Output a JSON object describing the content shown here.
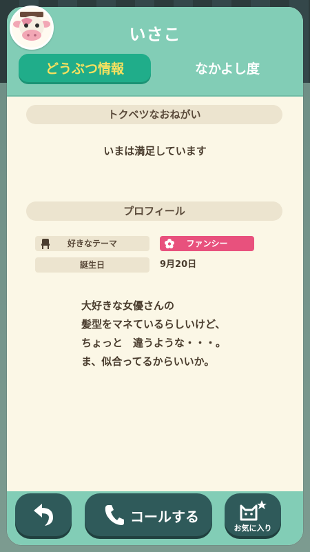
{
  "header": {
    "villager_name": "いさこ",
    "avatar_icon": "cow-villager-icon"
  },
  "tabs": [
    {
      "label": "どうぶつ情報",
      "active": true
    },
    {
      "label": "なかよし度",
      "active": false
    }
  ],
  "wish_section": {
    "title": "トクベツなおねがい",
    "text": "いまは満足しています"
  },
  "profile_section": {
    "title": "プロフィール",
    "fields": [
      {
        "label": "好きなテーマ",
        "icon": "chair-icon",
        "value": "ファンシー",
        "value_icon": "flower-icon"
      },
      {
        "label": "誕生日",
        "value": "9月20日"
      }
    ],
    "quote_lines": [
      "大好きな女優さんの",
      "髪型をマネているらしいけど、",
      "ちょっと　違うような・・・。",
      "ま、似合ってるからいいか。"
    ]
  },
  "footer": {
    "back_icon": "back-arrow-icon",
    "call_label": "コールする",
    "call_icon": "phone-icon",
    "favorite_label": "お気に入り",
    "favorite_icon": "cat-star-icon"
  },
  "colors": {
    "header": "#82cdb6",
    "tab_active": "#20ad8a",
    "tab_active_text": "#f7e15f",
    "theme_badge": "#e8517d",
    "button": "#2f5a5a"
  }
}
